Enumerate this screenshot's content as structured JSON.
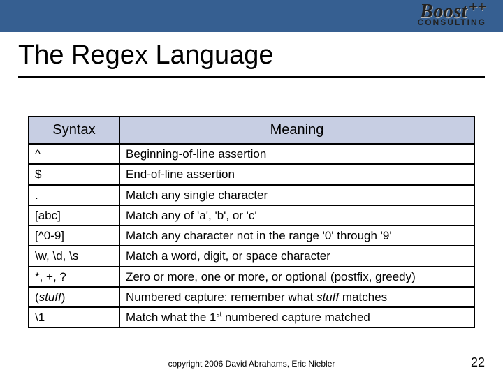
{
  "logo": {
    "main": "Boost",
    "plus": "++",
    "sub": "CONSULTING"
  },
  "title": "The Regex Language",
  "table": {
    "headers": {
      "syntax": "Syntax",
      "meaning": "Meaning"
    },
    "rows": [
      {
        "syntax": "^",
        "meaning": "Beginning-of-line assertion"
      },
      {
        "syntax": "$",
        "meaning": "End-of-line assertion"
      },
      {
        "syntax": ".",
        "meaning": "Match any single character"
      },
      {
        "syntax": "[abc]",
        "meaning": "Match any of 'a', 'b', or 'c'"
      },
      {
        "syntax": "[^0-9]",
        "meaning": "Match any character not in the range '0' through '9'"
      },
      {
        "syntax": "\\w, \\d, \\s",
        "meaning": "Match a word, digit, or space character"
      },
      {
        "syntax": "*, +, ?",
        "meaning": "Zero or more, one or more, or optional (postfix, greedy)"
      },
      {
        "syntax_html": "(<span class=\"italic\">stuff</span>)",
        "meaning_html": "Numbered capture: remember what <span class=\"italic\">stuff</span> matches"
      },
      {
        "syntax": "\\1",
        "meaning_html": "Match what the 1<sup>st</sup> numbered capture matched"
      }
    ]
  },
  "footer": "copyright 2006 David Abrahams, Eric Niebler",
  "page": "22"
}
